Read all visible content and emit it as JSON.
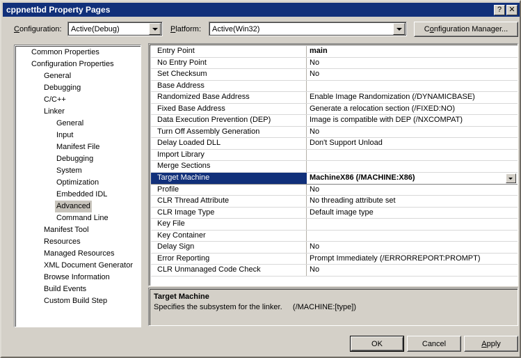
{
  "window": {
    "title": "cppnettbd Property Pages",
    "titlebar_color": "#11307a",
    "face_color": "#d4d0c8",
    "help_button": "?",
    "close_button": "✕"
  },
  "config_bar": {
    "configuration_label": "Configuration:",
    "configuration_accel": "C",
    "configuration_value": "Active(Debug)",
    "platform_label": "Platform:",
    "platform_accel": "P",
    "platform_value": "Active(Win32)",
    "configuration_manager_label": "Configuration Manager...",
    "configuration_manager_accel": "o"
  },
  "tree": {
    "selected": "Advanced",
    "items": [
      {
        "label": "Common Properties",
        "indent": 0,
        "selected": false
      },
      {
        "label": "Configuration Properties",
        "indent": 0,
        "selected": false
      },
      {
        "label": "General",
        "indent": 1,
        "selected": false
      },
      {
        "label": "Debugging",
        "indent": 1,
        "selected": false
      },
      {
        "label": "C/C++",
        "indent": 1,
        "selected": false
      },
      {
        "label": "Linker",
        "indent": 1,
        "selected": false
      },
      {
        "label": "General",
        "indent": 2,
        "selected": false
      },
      {
        "label": "Input",
        "indent": 2,
        "selected": false
      },
      {
        "label": "Manifest File",
        "indent": 2,
        "selected": false
      },
      {
        "label": "Debugging",
        "indent": 2,
        "selected": false
      },
      {
        "label": "System",
        "indent": 2,
        "selected": false
      },
      {
        "label": "Optimization",
        "indent": 2,
        "selected": false
      },
      {
        "label": "Embedded IDL",
        "indent": 2,
        "selected": false
      },
      {
        "label": "Advanced",
        "indent": 2,
        "selected": true
      },
      {
        "label": "Command Line",
        "indent": 2,
        "selected": false
      },
      {
        "label": "Manifest Tool",
        "indent": 1,
        "selected": false
      },
      {
        "label": "Resources",
        "indent": 1,
        "selected": false
      },
      {
        "label": "Managed Resources",
        "indent": 1,
        "selected": false
      },
      {
        "label": "XML Document Generator",
        "indent": 1,
        "selected": false
      },
      {
        "label": "Browse Information",
        "indent": 1,
        "selected": false
      },
      {
        "label": "Build Events",
        "indent": 1,
        "selected": false
      },
      {
        "label": "Custom Build Step",
        "indent": 1,
        "selected": false
      }
    ]
  },
  "grid": {
    "selected_row": "Target Machine",
    "rows": [
      {
        "name": "Entry Point",
        "value": "main",
        "bold": true,
        "selected": false,
        "dropdown": false
      },
      {
        "name": "No Entry Point",
        "value": "No",
        "bold": false,
        "selected": false,
        "dropdown": false
      },
      {
        "name": "Set Checksum",
        "value": "No",
        "bold": false,
        "selected": false,
        "dropdown": false
      },
      {
        "name": "Base Address",
        "value": "",
        "bold": false,
        "selected": false,
        "dropdown": false
      },
      {
        "name": "Randomized Base Address",
        "value": "Enable Image Randomization (/DYNAMICBASE)",
        "bold": false,
        "selected": false,
        "dropdown": false
      },
      {
        "name": "Fixed Base Address",
        "value": "Generate a relocation section (/FIXED:NO)",
        "bold": false,
        "selected": false,
        "dropdown": false
      },
      {
        "name": "Data Execution Prevention (DEP)",
        "value": "Image is compatible with DEP (/NXCOMPAT)",
        "bold": false,
        "selected": false,
        "dropdown": false
      },
      {
        "name": "Turn Off Assembly Generation",
        "value": "No",
        "bold": false,
        "selected": false,
        "dropdown": false
      },
      {
        "name": "Delay Loaded DLL",
        "value": "Don't Support Unload",
        "bold": false,
        "selected": false,
        "dropdown": false
      },
      {
        "name": "Import Library",
        "value": "",
        "bold": false,
        "selected": false,
        "dropdown": false
      },
      {
        "name": "Merge Sections",
        "value": "",
        "bold": false,
        "selected": false,
        "dropdown": false
      },
      {
        "name": "Target Machine",
        "value": "MachineX86 (/MACHINE:X86)",
        "bold": true,
        "selected": true,
        "dropdown": true
      },
      {
        "name": "Profile",
        "value": "No",
        "bold": false,
        "selected": false,
        "dropdown": false
      },
      {
        "name": "CLR Thread Attribute",
        "value": "No threading attribute set",
        "bold": false,
        "selected": false,
        "dropdown": false
      },
      {
        "name": "CLR Image Type",
        "value": "Default image type",
        "bold": false,
        "selected": false,
        "dropdown": false
      },
      {
        "name": "Key File",
        "value": "",
        "bold": false,
        "selected": false,
        "dropdown": false
      },
      {
        "name": "Key Container",
        "value": "",
        "bold": false,
        "selected": false,
        "dropdown": false
      },
      {
        "name": "Delay Sign",
        "value": "No",
        "bold": false,
        "selected": false,
        "dropdown": false
      },
      {
        "name": "Error Reporting",
        "value": "Prompt Immediately (/ERRORREPORT:PROMPT)",
        "bold": false,
        "selected": false,
        "dropdown": false
      },
      {
        "name": "CLR Unmanaged Code Check",
        "value": "No",
        "bold": false,
        "selected": false,
        "dropdown": false
      }
    ]
  },
  "description": {
    "title": "Target Machine",
    "text": "Specifies the subsystem for the linker.     (/MACHINE:[type])"
  },
  "buttons": {
    "ok": "OK",
    "cancel": "Cancel",
    "apply": "Apply",
    "apply_accel": "A"
  }
}
